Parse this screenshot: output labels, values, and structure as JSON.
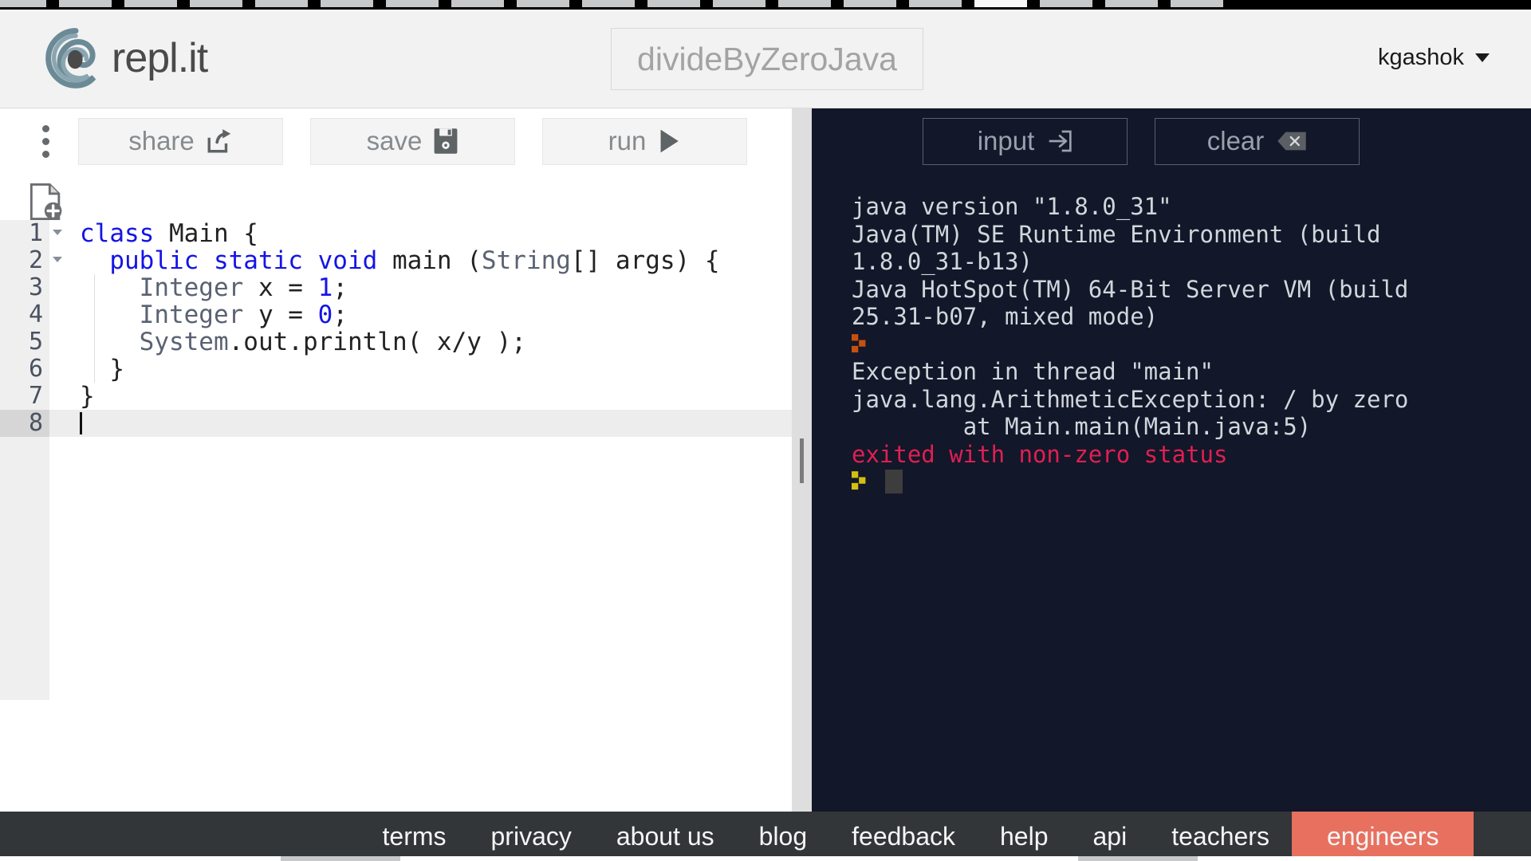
{
  "browser": {
    "tab_stub_count": 19,
    "active_tab_index": 15
  },
  "header": {
    "logo_text": "repl.it",
    "logo_icon": "replit-swirl-logo-icon",
    "project_title": "divideByZeroJava",
    "project_title_placeholder": "divideByZeroJava",
    "username": "kgashok",
    "caret_icon": "chevron-down-icon"
  },
  "editor": {
    "kebab_icon": "kebab-menu-icon",
    "new_file_icon": "new-file-icon",
    "toolbar": {
      "share_label": "share",
      "share_icon": "share-external-icon",
      "save_label": "save",
      "save_icon": "floppy-disk-icon",
      "run_label": "run",
      "run_icon": "play-triangle-icon"
    },
    "active_line": 8,
    "lines": [
      {
        "n": "1",
        "fold": true,
        "indent": false,
        "tokens": [
          {
            "t": "class ",
            "c": "kw"
          },
          {
            "t": "Main {",
            "c": "plain"
          }
        ]
      },
      {
        "n": "2",
        "fold": true,
        "indent": false,
        "tokens": [
          {
            "t": "  ",
            "c": "plain"
          },
          {
            "t": "public static void ",
            "c": "kw"
          },
          {
            "t": "main (",
            "c": "plain"
          },
          {
            "t": "String",
            "c": "type"
          },
          {
            "t": "[] args) {",
            "c": "plain"
          }
        ]
      },
      {
        "n": "3",
        "fold": false,
        "indent": true,
        "tokens": [
          {
            "t": "    ",
            "c": "plain"
          },
          {
            "t": "Integer",
            "c": "type"
          },
          {
            "t": " x = ",
            "c": "plain"
          },
          {
            "t": "1",
            "c": "num"
          },
          {
            "t": ";",
            "c": "plain"
          }
        ]
      },
      {
        "n": "4",
        "fold": false,
        "indent": true,
        "tokens": [
          {
            "t": "    ",
            "c": "plain"
          },
          {
            "t": "Integer",
            "c": "type"
          },
          {
            "t": " y = ",
            "c": "plain"
          },
          {
            "t": "0",
            "c": "num"
          },
          {
            "t": ";",
            "c": "plain"
          }
        ]
      },
      {
        "n": "5",
        "fold": false,
        "indent": true,
        "tokens": [
          {
            "t": "    ",
            "c": "plain"
          },
          {
            "t": "System",
            "c": "type"
          },
          {
            "t": ".out.println( x/y );",
            "c": "plain"
          }
        ]
      },
      {
        "n": "6",
        "fold": false,
        "indent": true,
        "tokens": [
          {
            "t": "  }",
            "c": "plain"
          }
        ]
      },
      {
        "n": "7",
        "fold": false,
        "indent": false,
        "tokens": [
          {
            "t": "}",
            "c": "plain"
          }
        ]
      },
      {
        "n": "8",
        "fold": false,
        "indent": false,
        "caret": true,
        "tokens": []
      }
    ]
  },
  "console": {
    "toolbar": {
      "input_label": "input",
      "input_icon": "sign-in-arrow-icon",
      "clear_label": "clear",
      "clear_icon": "backspace-icon"
    },
    "output": [
      {
        "kind": "text",
        "text": "java version \"1.8.0_31\""
      },
      {
        "kind": "text",
        "text": "Java(TM) SE Runtime Environment (build"
      },
      {
        "kind": "text",
        "text": "1.8.0_31-b13)"
      },
      {
        "kind": "text",
        "text": "Java HotSpot(TM) 64-Bit Server VM (build"
      },
      {
        "kind": "text",
        "text": "25.31-b07, mixed mode)"
      },
      {
        "kind": "prompt",
        "color": "#c8500f",
        "text": ""
      },
      {
        "kind": "text",
        "text": "Exception in thread \"main\""
      },
      {
        "kind": "text",
        "text": "java.lang.ArithmeticException: / by zero"
      },
      {
        "kind": "text",
        "text": "        at Main.main(Main.java:5)"
      },
      {
        "kind": "error",
        "text": "exited with non-zero status"
      },
      {
        "kind": "prompt",
        "color": "#d4c013",
        "text": "",
        "cursor": true
      }
    ]
  },
  "footer": {
    "links": [
      {
        "label": "terms",
        "accent": false
      },
      {
        "label": "privacy",
        "accent": false
      },
      {
        "label": "about us",
        "accent": false
      },
      {
        "label": "blog",
        "accent": false
      },
      {
        "label": "feedback",
        "accent": false
      },
      {
        "label": "help",
        "accent": false
      },
      {
        "label": "api",
        "accent": false
      },
      {
        "label": "teachers",
        "accent": false
      },
      {
        "label": "engineers",
        "accent": true
      }
    ]
  },
  "colors": {
    "header_bg": "#f2f2f2",
    "console_bg": "#121729",
    "footer_bg": "#323639",
    "accent": "#e8705f",
    "error_text": "#e01f52",
    "keyword": "#1414e6",
    "type": "#5a6272"
  }
}
